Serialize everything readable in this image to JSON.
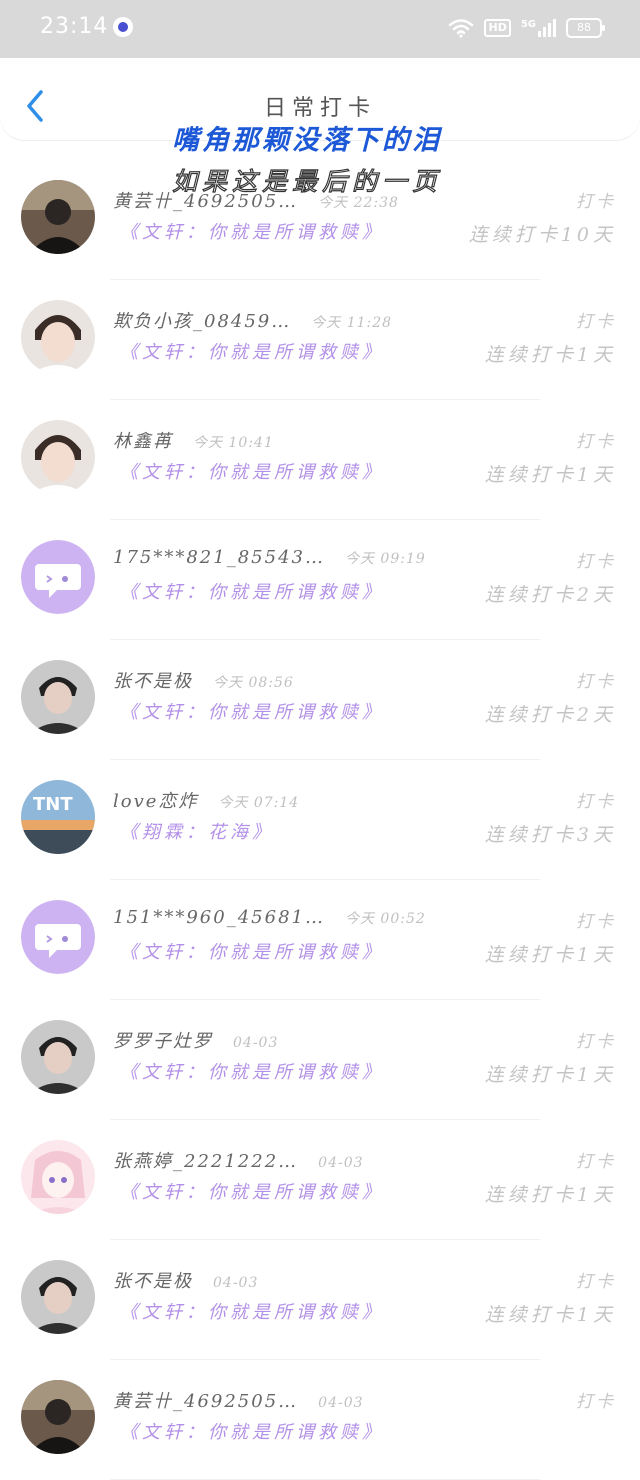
{
  "status_bar": {
    "time": "23:14",
    "hd": "HD",
    "network": "5G",
    "battery": "88"
  },
  "header": {
    "title": "日常打卡"
  },
  "overlay_lyrics": {
    "line1": "嘴角那颗没落下的泪",
    "line2": "如果这是最后的一页"
  },
  "checkins": [
    {
      "name": "黄芸卄_4692505…",
      "time": "今天 22:38",
      "song": "《文轩：你就是所谓救赎》",
      "label": "打卡",
      "streak": "连续打卡10天",
      "avatar": "photo-dark"
    },
    {
      "name": "欺负小孩_08459…",
      "time": "今天 11:28",
      "song": "《文轩：你就是所谓救赎》",
      "label": "打卡",
      "streak": "连续打卡1天",
      "avatar": "photo-light"
    },
    {
      "name": "林鑫苒",
      "time": "今天 10:41",
      "song": "《文轩：你就是所谓救赎》",
      "label": "打卡",
      "streak": "连续打卡1天",
      "avatar": "photo-light"
    },
    {
      "name": "175***821_85543…",
      "time": "今天 09:19",
      "song": "《文轩：你就是所谓救赎》",
      "label": "打卡",
      "streak": "连续打卡2天",
      "avatar": "default"
    },
    {
      "name": "张不是极",
      "time": "今天 08:56",
      "song": "《文轩：你就是所谓救赎》",
      "label": "打卡",
      "streak": "连续打卡2天",
      "avatar": "photo-gray"
    },
    {
      "name": "love恋炸",
      "time": "今天 07:14",
      "song": "《翔霖：花海》",
      "label": "打卡",
      "streak": "连续打卡3天",
      "avatar": "photo-sky"
    },
    {
      "name": "151***960_45681…",
      "time": "今天 00:52",
      "song": "《文轩：你就是所谓救赎》",
      "label": "打卡",
      "streak": "连续打卡1天",
      "avatar": "default"
    },
    {
      "name": "罗罗子灶罗",
      "time": "04-03",
      "song": "《文轩：你就是所谓救赎》",
      "label": "打卡",
      "streak": "连续打卡1天",
      "avatar": "photo-gray"
    },
    {
      "name": "张燕婷_2221222…",
      "time": "04-03",
      "song": "《文轩：你就是所谓救赎》",
      "label": "打卡",
      "streak": "连续打卡1天",
      "avatar": "photo-pink"
    },
    {
      "name": "张不是极",
      "time": "04-03",
      "song": "《文轩：你就是所谓救赎》",
      "label": "打卡",
      "streak": "连续打卡1天",
      "avatar": "photo-gray"
    },
    {
      "name": "黄芸卄_4692505…",
      "time": "04-03",
      "song": "《文轩：你就是所谓救赎》",
      "label": "打卡",
      "streak": "",
      "avatar": "photo-dark"
    }
  ],
  "colors": {
    "accent_blue": "#2f8fe8",
    "song_purple": "#b391e8",
    "default_avatar": "#cdb3f2"
  }
}
